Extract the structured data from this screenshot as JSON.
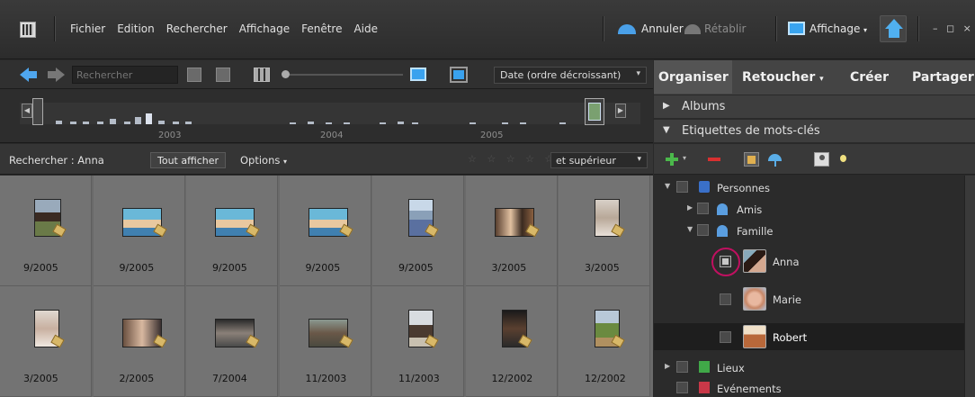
{
  "menubar": {
    "items": [
      "Fichier",
      "Edition",
      "Rechercher",
      "Affichage",
      "Fenêtre",
      "Aide"
    ],
    "undo": "Annuler",
    "redo": "Rétablir",
    "display": "Affichage",
    "display_caret": "▾",
    "window_controls": "– ◻ ×"
  },
  "toolbar": {
    "search_placeholder": "Rechercher",
    "sort_label": "Date (ordre décroissant)",
    "chevron": "▾"
  },
  "timeline": {
    "years": [
      "2003",
      "2004",
      "2005"
    ],
    "left_arrow": "◀",
    "right_arrow": "▶"
  },
  "filterbar": {
    "search_label": "Rechercher : Anna",
    "show_all": "Tout afficher",
    "options": "Options",
    "options_caret": "▾",
    "stars": "☆ ☆ ☆ ☆ ☆",
    "rating_filter": "et supérieur"
  },
  "photos": {
    "dates": [
      "9/2005",
      "9/2005",
      "9/2005",
      "9/2005",
      "9/2005",
      "3/2005",
      "3/2005",
      "3/2005",
      "2/2005",
      "7/2004",
      "11/2003",
      "11/2003",
      "12/2002",
      "12/2002"
    ]
  },
  "panel": {
    "tabs": [
      "Organiser",
      "Retoucher",
      "Créer",
      "Partager"
    ],
    "retoucher_caret": "▾",
    "albums": "Albums",
    "keyword_tags": "Etiquettes de mots-clés",
    "collapsed_arrow": "▶",
    "expanded_arrow": "▼",
    "tree_expanded": "▼",
    "tree_collapsed": "▶",
    "tags": {
      "people": "Personnes",
      "friends": "Amis",
      "family": "Famille",
      "anna": "Anna",
      "marie": "Marie",
      "robert": "Robert",
      "places": "Lieux",
      "events": "Evénements"
    }
  },
  "colors": {
    "accent_blue": "#3aa2ee",
    "highlight_ring": "#c01060",
    "add_green": "#4bb84b",
    "remove_red": "#d83030"
  }
}
